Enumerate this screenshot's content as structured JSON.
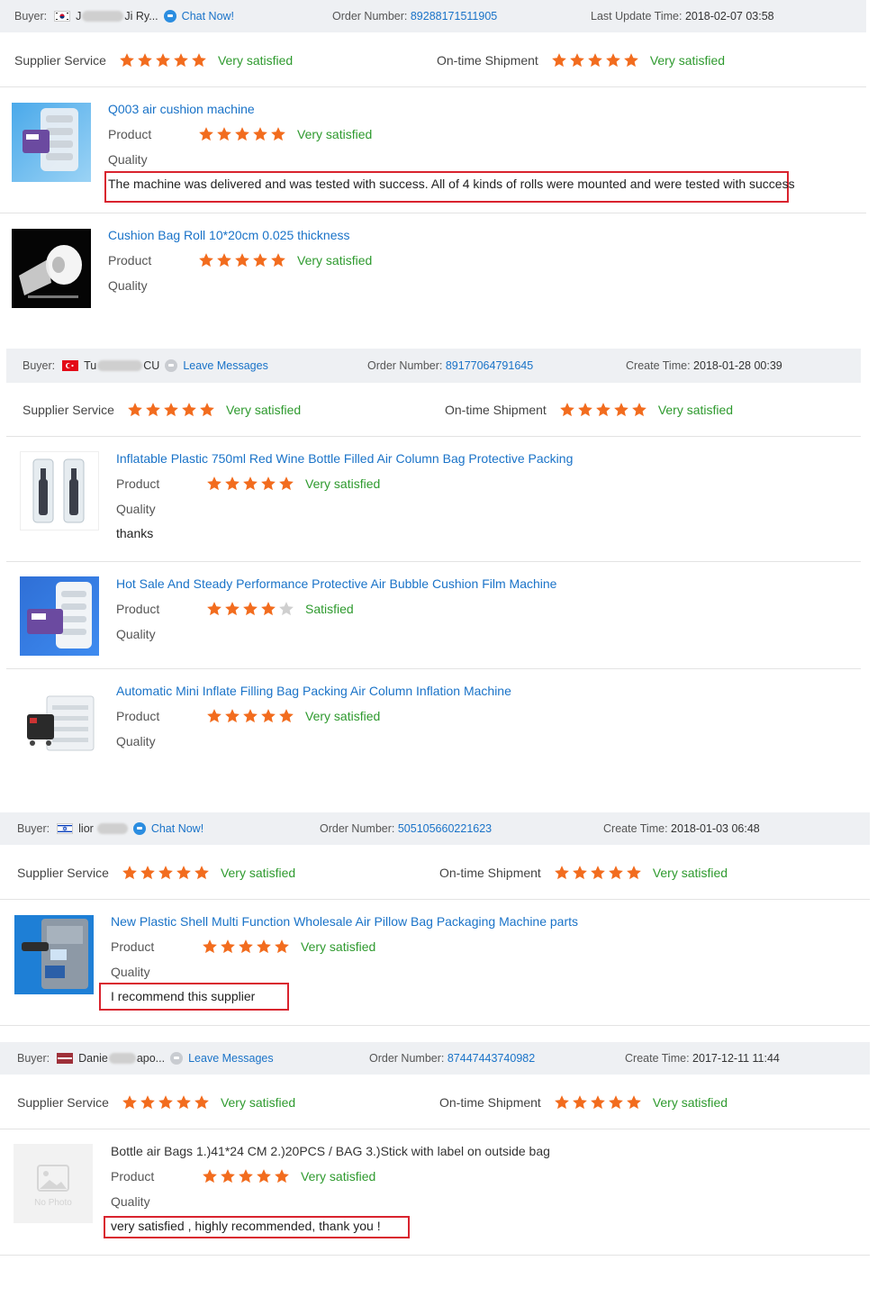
{
  "labels": {
    "buyer": "Buyer:",
    "order_number": "Order Number:",
    "last_update": "Last Update Time:",
    "create_time": "Create Time:",
    "supplier_service": "Supplier Service",
    "ontime_shipment": "On-time Shipment",
    "product": "Product",
    "quality": "Quality",
    "no_photo": "No Photo"
  },
  "colors": {
    "star_on": "#f26c1e",
    "star_off": "#cfcfcf",
    "satisfied": "#2e9a2e",
    "link": "#1a73c8",
    "red_box": "#d9232e"
  },
  "orders": [
    {
      "buyer_flag": "korea-flag-icon",
      "buyer_pre": "J",
      "buyer_post": "Ji Ry...",
      "action": "Chat Now!",
      "order_number": "89288171511905",
      "time_label": "Last Update Time:",
      "time": "2018-02-07 03:58",
      "supplier_service": {
        "stars": 5,
        "text": "Very satisfied"
      },
      "ontime_shipment": {
        "stars": 5,
        "text": "Very satisfied"
      },
      "products": [
        {
          "title": "Q003 air cushion machine",
          "stars": 5,
          "rating": "Very satisfied",
          "comment": "The machine was delivered and was tested with success. All of 4 kinds of rolls were mounted and were tested with success"
        },
        {
          "title": "Cushion Bag Roll 10*20cm 0.025 thickness",
          "stars": 5,
          "rating": "Very satisfied",
          "comment": ""
        }
      ]
    },
    {
      "buyer_flag": "turkey-flag-icon",
      "buyer_pre": "Tu",
      "buyer_post": "CU",
      "action": "Leave Messages",
      "order_number": "89177064791645",
      "time_label": "Create Time:",
      "time": "2018-01-28 00:39",
      "supplier_service": {
        "stars": 5,
        "text": "Very satisfied"
      },
      "ontime_shipment": {
        "stars": 5,
        "text": "Very satisfied"
      },
      "products": [
        {
          "title": "Inflatable Plastic 750ml Red Wine Bottle Filled Air Column Bag Protective Packing",
          "stars": 5,
          "rating": "Very satisfied",
          "comment": "thanks"
        },
        {
          "title": "Hot Sale And Steady Performance Protective Air Bubble Cushion Film Machine",
          "stars": 4,
          "rating": "Satisfied",
          "comment": ""
        },
        {
          "title": "Automatic Mini Inflate Filling Bag Packing Air Column Inflation Machine",
          "stars": 5,
          "rating": "Very satisfied",
          "comment": ""
        }
      ]
    },
    {
      "buyer_flag": "israel-flag-icon",
      "buyer_pre": "lior",
      "buyer_post": "",
      "action": "Chat Now!",
      "order_number": "505105660221623",
      "time_label": "Create Time:",
      "time": "2018-01-03 06:48",
      "supplier_service": {
        "stars": 5,
        "text": "Very satisfied"
      },
      "ontime_shipment": {
        "stars": 5,
        "text": "Very satisfied"
      },
      "products": [
        {
          "title": "New Plastic Shell Multi Function Wholesale Air Pillow Bag Packaging Machine parts",
          "stars": 5,
          "rating": "Very satisfied",
          "comment": "I recommend this supplier"
        }
      ]
    },
    {
      "buyer_flag": "latvia-flag-icon",
      "buyer_pre": "Danie",
      "buyer_post": "apo...",
      "action": "Leave Messages",
      "order_number": "87447443740982",
      "time_label": "Create Time:",
      "time": "2017-12-11 11:44",
      "supplier_service": {
        "stars": 5,
        "text": "Very satisfied"
      },
      "ontime_shipment": {
        "stars": 5,
        "text": "Very satisfied"
      },
      "products": [
        {
          "title": "Bottle air Bags 1.)41*24 CM 2.)20PCS / BAG 3.)Stick with label on outside bag",
          "stars": 5,
          "rating": "Very satisfied",
          "comment": "very satisfied , highly recommended, thank you !"
        }
      ]
    }
  ]
}
